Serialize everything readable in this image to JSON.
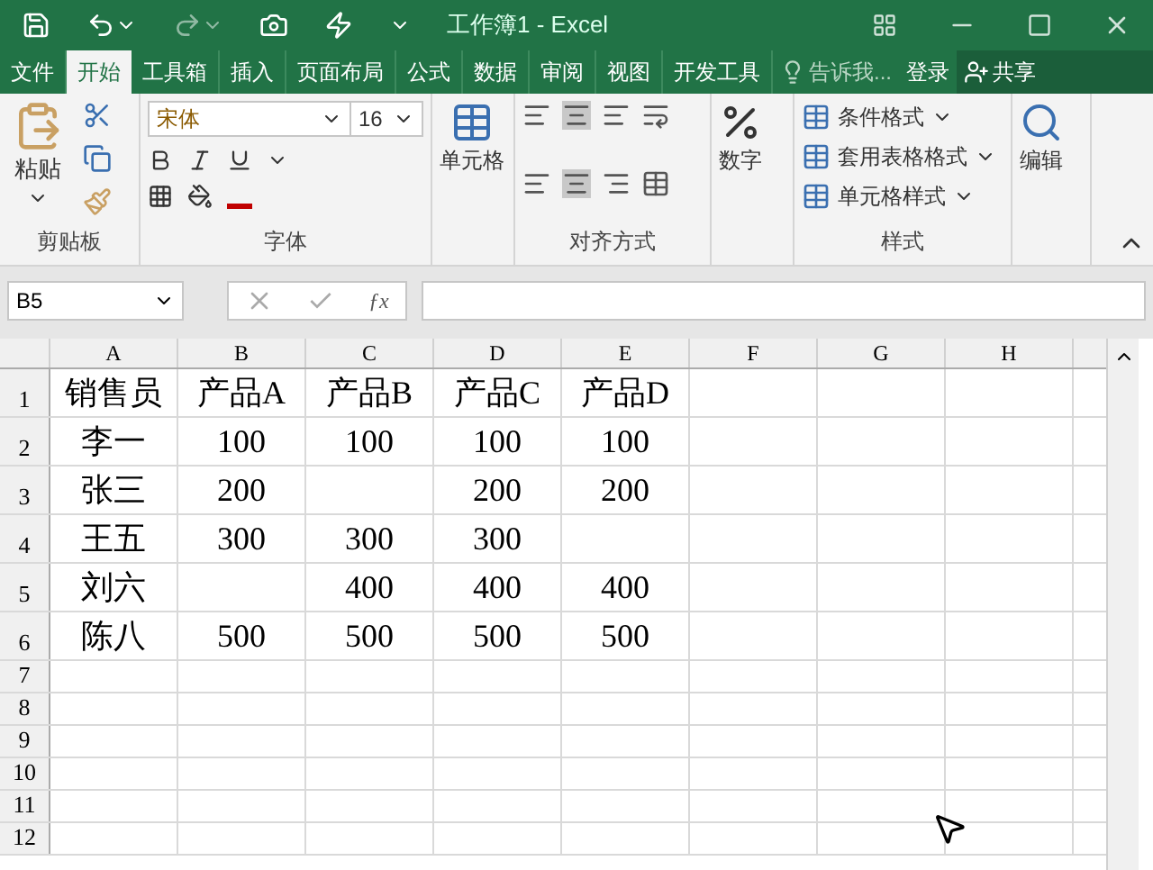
{
  "window": {
    "title": "工作簿1 - Excel"
  },
  "tabs": [
    {
      "label": "文件",
      "selected": false
    },
    {
      "label": "开始",
      "selected": true
    },
    {
      "label": "工具箱",
      "selected": false
    },
    {
      "label": "插入",
      "selected": false
    },
    {
      "label": "页面布局",
      "selected": false
    },
    {
      "label": "公式",
      "selected": false
    },
    {
      "label": "数据",
      "selected": false
    },
    {
      "label": "审阅",
      "selected": false
    },
    {
      "label": "视图",
      "selected": false
    },
    {
      "label": "开发工具",
      "selected": false
    }
  ],
  "tell_me": {
    "placeholder": "告诉我..."
  },
  "sign_in": "登录",
  "share": "共享",
  "ribbon": {
    "clipboard": {
      "paste": "粘贴",
      "label": "剪贴板"
    },
    "font": {
      "font_name": "宋体",
      "font_size": "16",
      "label": "字体"
    },
    "cells": {
      "label": "单元格"
    },
    "alignment": {
      "label": "对齐方式"
    },
    "number": {
      "label": "数字"
    },
    "styles": {
      "items": [
        "条件格式",
        "套用表格格式",
        "单元格样式"
      ],
      "label": "样式"
    },
    "editing": {
      "label": "编辑"
    }
  },
  "formula_bar": {
    "name_box": "B5",
    "function_label": "ƒx"
  },
  "sheet": {
    "columns": [
      "A",
      "B",
      "C",
      "D",
      "E",
      "F",
      "G",
      "H"
    ],
    "rows": [
      {
        "number": "1",
        "cells": [
          "销售员",
          "产品A",
          "产品B",
          "产品C",
          "产品D"
        ]
      },
      {
        "number": "2",
        "cells": [
          "李一",
          "100",
          "100",
          "100",
          "100"
        ]
      },
      {
        "number": "3",
        "cells": [
          "张三",
          "200",
          "",
          "200",
          "200"
        ]
      },
      {
        "number": "4",
        "cells": [
          "王五",
          "300",
          "300",
          "300",
          ""
        ]
      },
      {
        "number": "5",
        "cells": [
          "刘六",
          "",
          "400",
          "400",
          "400"
        ]
      },
      {
        "number": "6",
        "cells": [
          "陈八",
          "500",
          "500",
          "500",
          "500"
        ]
      },
      {
        "number": "7",
        "cells": []
      },
      {
        "number": "8",
        "cells": []
      },
      {
        "number": "9",
        "cells": []
      },
      {
        "number": "10",
        "cells": []
      },
      {
        "number": "11",
        "cells": []
      },
      {
        "number": "12",
        "cells": []
      }
    ]
  }
}
